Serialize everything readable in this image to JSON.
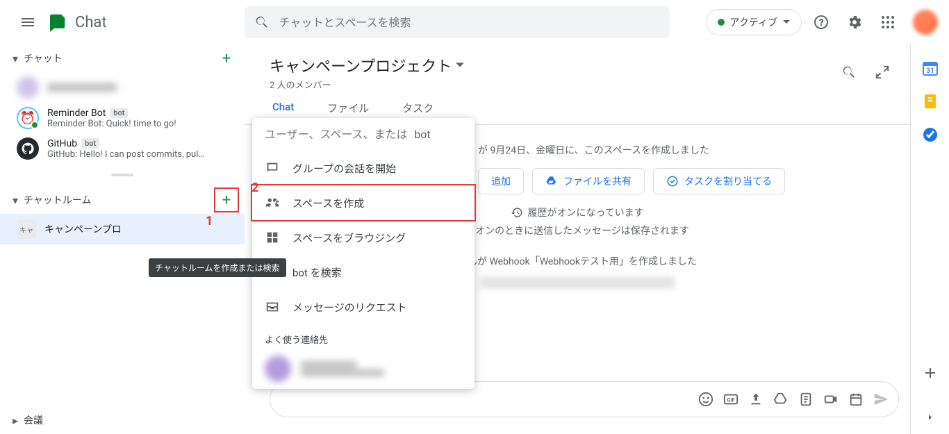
{
  "app": {
    "name": "Chat"
  },
  "search": {
    "placeholder": "チャットとスペースを検索"
  },
  "status": {
    "label": "アクティブ"
  },
  "sidebar": {
    "chat_section": "チャット",
    "room_section": "チャットルーム",
    "meet_section": "会議",
    "tooltip_new_room": "チャットルームを作成または検索",
    "items": [
      {
        "name": "",
        "sub": ""
      },
      {
        "name": "Reminder Bot",
        "sub": "Reminder Bot: Quick! time to go!",
        "bot": "bot"
      },
      {
        "name": "GitHub",
        "sub": "GitHub: Hello! I can post commits, pul…",
        "bot": "bot"
      }
    ],
    "room_item": {
      "badge": "キャ",
      "name": "キャンペーンプロ"
    }
  },
  "conv": {
    "title": "キャンペーンプロジェクト",
    "members": "2 人のメンバー",
    "tabs": {
      "chat": "Chat",
      "file": "ファイル",
      "task": "タスク"
    },
    "created_line": "が 9月24日、金曜日に、このスペースを作成しました",
    "actions": {
      "add": "追加",
      "share": "ファイルを共有",
      "task": "タスクを割り当てる"
    },
    "history_on": "履歴がオンになっています",
    "history_sub": "がオンのときに送信したメッセージは保存されます",
    "webhook_line": "さんが Webhook「Webhookテスト用」を作成しました"
  },
  "popup": {
    "placeholder": "ユーザー、スペース、または",
    "bot_suffix": "bot",
    "items": {
      "start_group": "グループの会話を開始",
      "create_space": "スペースを作成",
      "browse_spaces": "スペースをブラウジング",
      "search_bot": "bot を検索",
      "msg_requests": "メッセージのリクエスト"
    },
    "freq_label": "よく使う連絡先"
  },
  "annotations": {
    "one": "1",
    "two": "2"
  }
}
